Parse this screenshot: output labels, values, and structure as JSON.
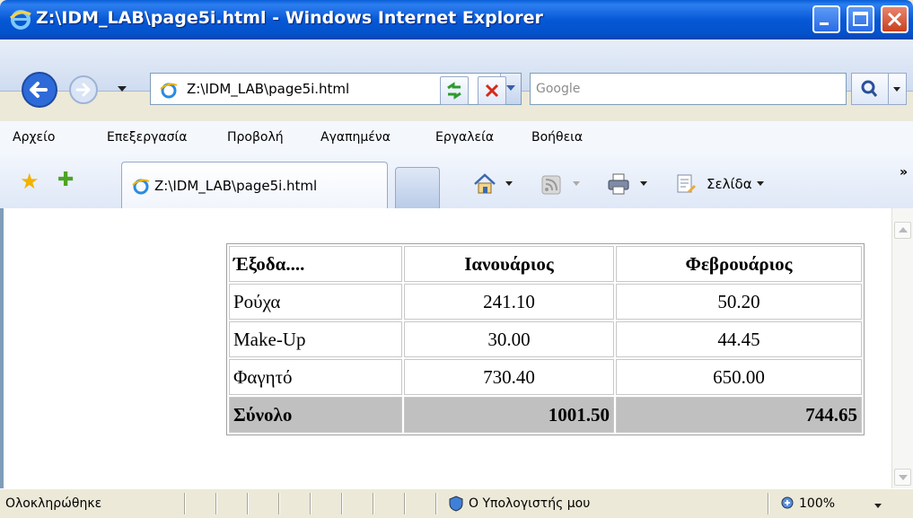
{
  "window": {
    "title": "Z:\\IDM_LAB\\page5i.html - Windows Internet Explorer"
  },
  "address_bar": {
    "url": "Z:\\IDM_LAB\\page5i.html"
  },
  "search": {
    "placeholder": "Google"
  },
  "menu": [
    "Αρχείο",
    "Επεξεργασία",
    "Προβολή",
    "Αγαπημένα",
    "Εργαλεία",
    "Βοήθεια"
  ],
  "tabs": [
    {
      "label": "Z:\\IDM_LAB\\page5i.html",
      "active": true
    }
  ],
  "toolbar": {
    "page_label": "Σελίδα"
  },
  "table": {
    "headers": [
      "Έξοδα....",
      "Ιανουάριος",
      "Φεβρουάριος"
    ],
    "rows": [
      [
        "Ρούχα",
        "241.10",
        "50.20"
      ],
      [
        "Make-Up",
        "30.00",
        "44.45"
      ],
      [
        "Φαγητό",
        "730.40",
        "650.00"
      ]
    ],
    "total": [
      "Σύνολο",
      "1001.50",
      "744.65"
    ]
  },
  "status": {
    "text": "Ολοκληρώθηκε",
    "zone": "Ο Υπολογιστής μου",
    "zoom": "100%"
  },
  "colors": {
    "titlebar": "#0758d6",
    "total_row_bg": "#c0c0c0",
    "close_button": "#c7401f"
  }
}
